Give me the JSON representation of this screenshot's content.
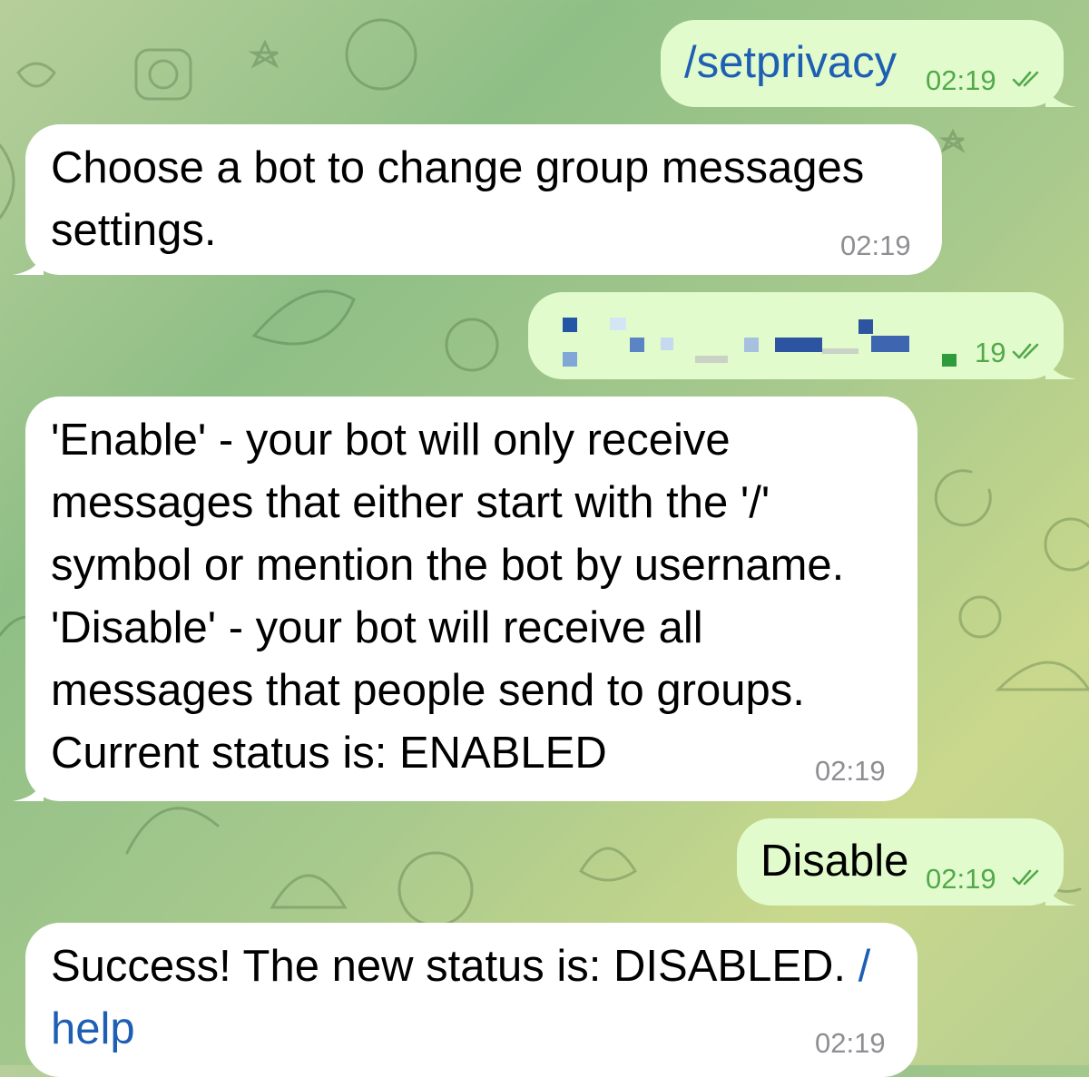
{
  "theme": {
    "incoming_bg": "#ffffff",
    "outgoing_bg": "#e2fbcd",
    "time_incoming": "#8e8e93",
    "time_outgoing": "#52a94a",
    "link_color": "#1e5fb3",
    "blur_blue": "#2456a6",
    "blur_green": "#2f9b3a"
  },
  "messages": [
    {
      "id": "m1",
      "direction": "outgoing",
      "text": "/setprivacy",
      "time": "02:19",
      "status_icon": "double-check-icon"
    },
    {
      "id": "m2",
      "direction": "incoming",
      "text_line1": "Choose a bot to change group messages",
      "text_line2": "settings.",
      "time": "02:19"
    },
    {
      "id": "m3",
      "direction": "outgoing",
      "text": "[pixelated bot username]",
      "time_partial": "19",
      "status_icon": "double-check-icon"
    },
    {
      "id": "m4",
      "direction": "incoming",
      "lines": [
        "'Enable' - your bot will only receive",
        "messages that either start with the '/'",
        "symbol or mention the bot by username.",
        "'Disable' - your bot will receive all",
        "messages that people send to groups.",
        "Current status is: ENABLED"
      ],
      "time": "02:19"
    },
    {
      "id": "m5",
      "direction": "outgoing",
      "text": "Disable",
      "time": "02:19",
      "status_icon": "double-check-icon"
    },
    {
      "id": "m6",
      "direction": "incoming",
      "text_prefix": "Success! The new status is: DISABLED.",
      "link_part1": "/",
      "link_part2": "help",
      "time": "02:19"
    }
  ]
}
